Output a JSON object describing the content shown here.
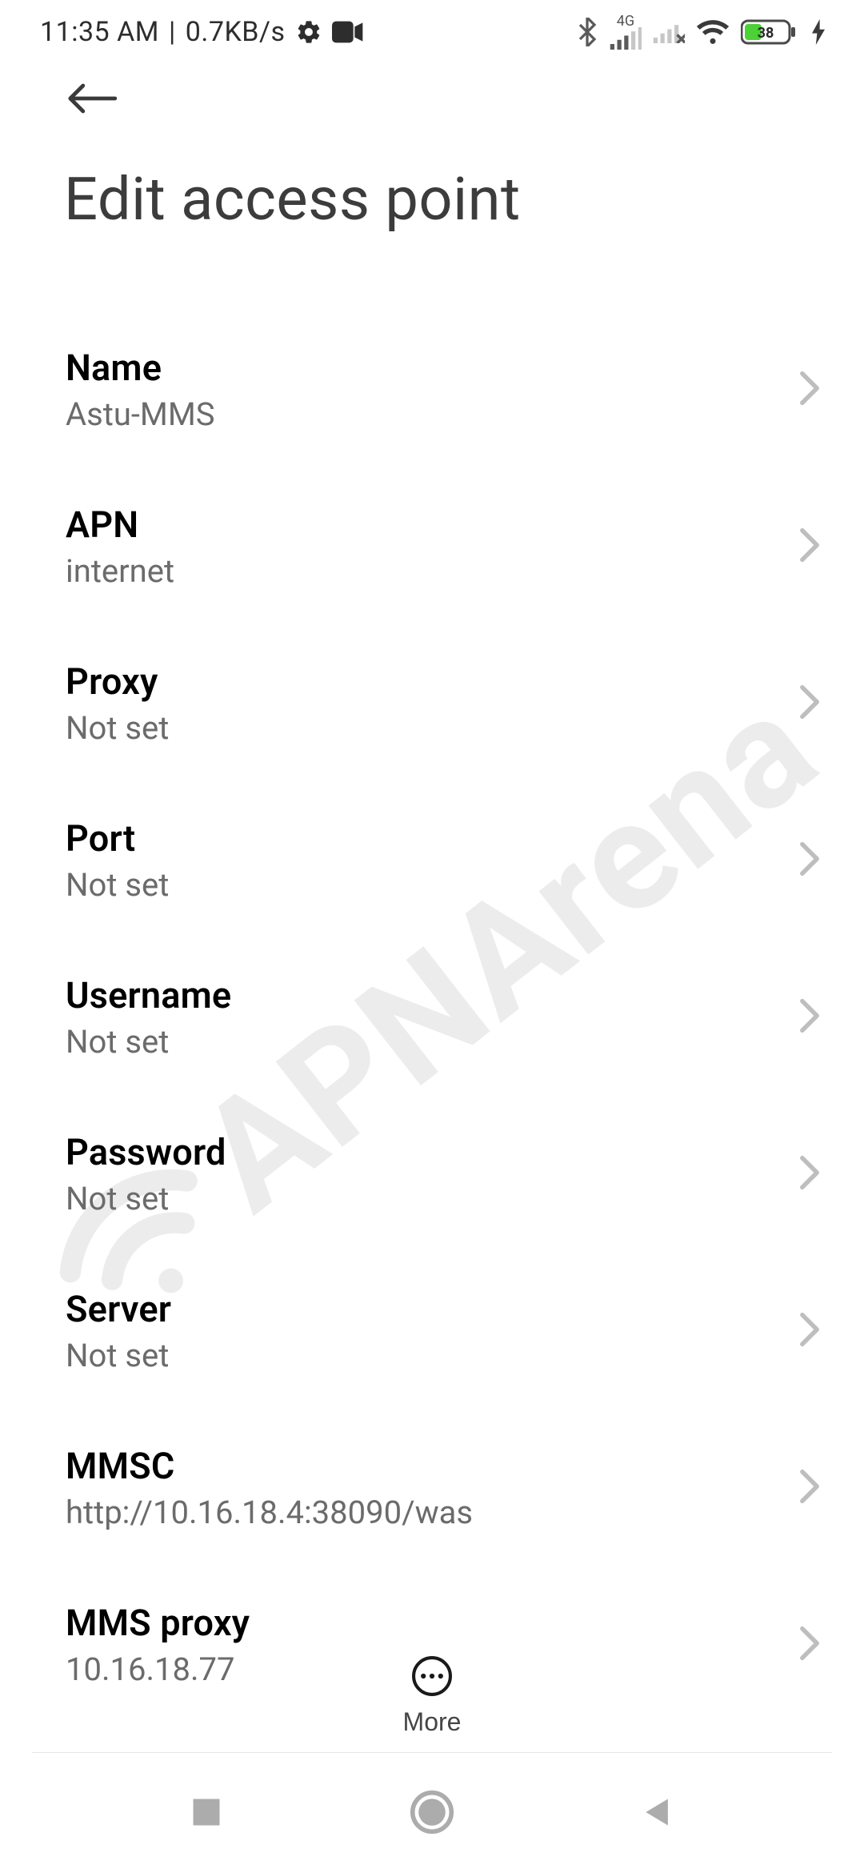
{
  "status_bar": {
    "time": "11:35 AM",
    "separator": "|",
    "net_speed": "0.7KB/s",
    "battery_percent": "38",
    "network_label": "4G"
  },
  "header": {
    "title": "Edit access point"
  },
  "settings": [
    {
      "label": "Name",
      "value": "Astu-MMS"
    },
    {
      "label": "APN",
      "value": "internet"
    },
    {
      "label": "Proxy",
      "value": "Not set"
    },
    {
      "label": "Port",
      "value": "Not set"
    },
    {
      "label": "Username",
      "value": "Not set"
    },
    {
      "label": "Password",
      "value": "Not set"
    },
    {
      "label": "Server",
      "value": "Not set"
    },
    {
      "label": "MMSC",
      "value": "http://10.16.18.4:38090/was"
    },
    {
      "label": "MMS proxy",
      "value": "10.16.18.77"
    }
  ],
  "toolbar": {
    "more_label": "More"
  },
  "watermark_text": "APNArena"
}
